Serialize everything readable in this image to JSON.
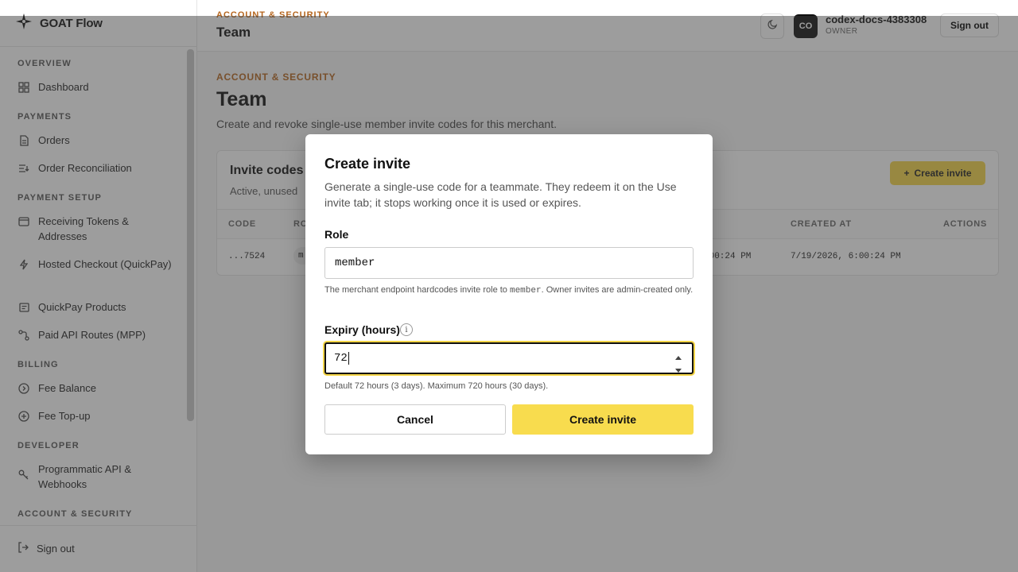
{
  "brand": {
    "name": "GOAT Flow"
  },
  "sidebar": {
    "sections": [
      {
        "label": "OVERVIEW"
      },
      {
        "label": "PAYMENTS"
      },
      {
        "label": "PAYMENT SETUP"
      },
      {
        "label": "BILLING"
      },
      {
        "label": "DEVELOPER"
      },
      {
        "label": "ACCOUNT & SECURITY"
      }
    ],
    "items": [
      {
        "label": "Dashboard",
        "icon": "grid-icon"
      },
      {
        "label": "Orders",
        "icon": "document-icon"
      },
      {
        "label": "Order Reconciliation",
        "icon": "reconcile-icon"
      },
      {
        "label": "Receiving Tokens & Addresses",
        "icon": "wallet-icon"
      },
      {
        "label": "Hosted Checkout (QuickPay)",
        "icon": "bolt-icon"
      },
      {
        "label": "QuickPay Products",
        "icon": "product-icon"
      },
      {
        "label": "Paid API Routes (MPP)",
        "icon": "route-icon"
      },
      {
        "label": "Fee Balance",
        "icon": "coin-icon"
      },
      {
        "label": "Fee Top-up",
        "icon": "plus-circle-icon"
      },
      {
        "label": "Programmatic API & Webhooks",
        "icon": "key-icon"
      }
    ],
    "sign_out": "Sign out"
  },
  "topbar": {
    "kicker": "ACCOUNT & SECURITY",
    "title": "Team",
    "avatar": "CO",
    "user_name": "codex-docs-4383308",
    "user_role": "OWNER",
    "sign_out": "Sign out"
  },
  "main": {
    "kicker": "ACCOUNT & SECURITY",
    "title": "Team",
    "description": "Create and revoke single-use member invite codes for this merchant.",
    "card": {
      "title": "Invite codes",
      "subtitle": "Active, unused",
      "create_label": "Create invite",
      "columns": {
        "code": "CODE",
        "role": "RO",
        "created_at": "CREATED AT",
        "actions": "ACTIONS"
      },
      "row": {
        "code": "...7524",
        "role": "m",
        "expires_partial": ":00:24 PM",
        "created_at": "7/19/2026, 6:00:24 PM"
      }
    }
  },
  "modal": {
    "title": "Create invite",
    "description": "Generate a single-use code for a teammate. They redeem it on the Use invite tab; it stops working once it is used or expires.",
    "role_label": "Role",
    "role_value": "member",
    "role_help_pre": "The merchant endpoint hardcodes invite role to ",
    "role_help_code": "member",
    "role_help_post": ". Owner invites are admin-created only.",
    "expiry_label": "Expiry (hours)",
    "expiry_value": "72",
    "expiry_help": "Default 72 hours (3 days). Maximum 720 hours (30 days).",
    "cancel_label": "Cancel",
    "create_label": "Create invite"
  },
  "colors": {
    "accent": "#f8dc4e",
    "kicker": "#b5651d"
  }
}
